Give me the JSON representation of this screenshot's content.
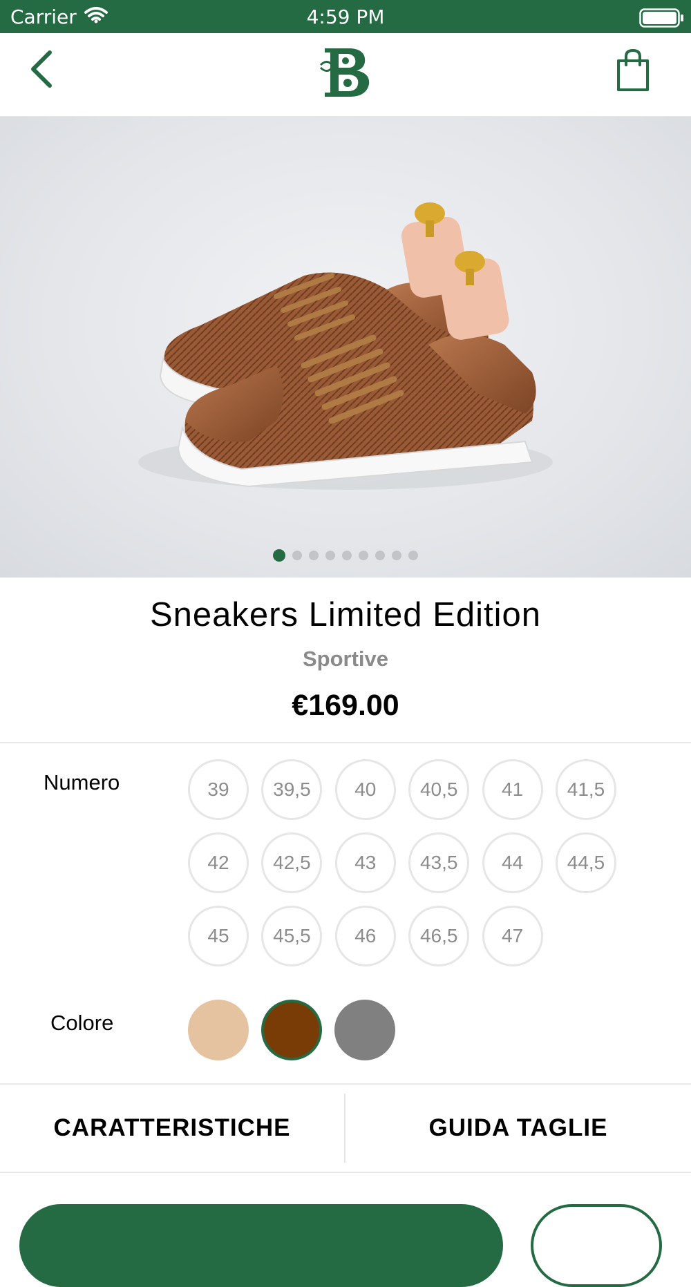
{
  "status_bar": {
    "carrier": "Carrier",
    "time": "4:59 PM"
  },
  "nav": {
    "back_icon": "chevron-left-icon",
    "logo_icon": "brand-b-logo",
    "cart_icon": "shopping-bag-icon"
  },
  "carousel": {
    "total_pages": 9,
    "current_page": 1
  },
  "product": {
    "title": "Sneakers Limited Edition",
    "category": "Sportive",
    "price": "€169.00"
  },
  "sizes": {
    "label": "Numero",
    "options": [
      "39",
      "39,5",
      "40",
      "40,5",
      "41",
      "41,5",
      "42",
      "42,5",
      "43",
      "43,5",
      "44",
      "44,5",
      "45",
      "45,5",
      "46",
      "46,5",
      "47"
    ]
  },
  "colors": {
    "label": "Colore",
    "options": [
      "#e6c3a0",
      "#7a3c06",
      "#808080"
    ],
    "selected_index": 1
  },
  "tabs": {
    "features": "CARATTERISTICHE",
    "size_guide": "GUIDA TAGLIE"
  },
  "theme": {
    "accent": "#246b43"
  }
}
